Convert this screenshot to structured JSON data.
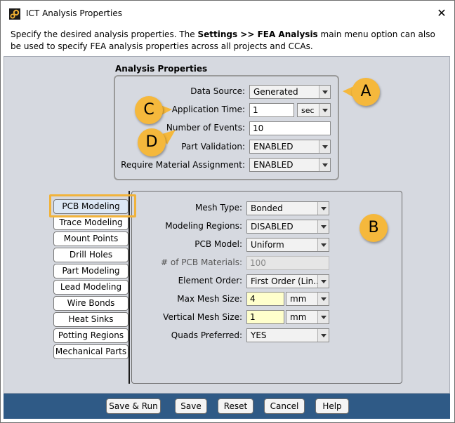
{
  "window": {
    "title": "ICT Analysis Properties",
    "close_glyph": "✕",
    "icon": "app-gear-icon"
  },
  "description": {
    "pre": "Specify the desired analysis properties. The ",
    "bold": "Settings >> FEA Analysis",
    "post": " main menu option can also be used to specify FEA analysis properties across all projects and CCAs."
  },
  "analysis_properties": {
    "title": "Analysis Properties",
    "data_source": {
      "label": "Data Source:",
      "value": "Generated"
    },
    "application_time": {
      "label": "Application Time:",
      "value": "1",
      "unit": "sec"
    },
    "number_of_events": {
      "label": "Number of Events:",
      "value": "10"
    },
    "part_validation": {
      "label": "Part Validation:",
      "value": "ENABLED"
    },
    "require_material": {
      "label": "Require Material Assignment:",
      "value": "ENABLED"
    }
  },
  "tabs": [
    {
      "label": "PCB Modeling",
      "active": true
    },
    {
      "label": "Trace Modeling"
    },
    {
      "label": "Mount Points"
    },
    {
      "label": "Drill Holes"
    },
    {
      "label": "Part Modeling"
    },
    {
      "label": "Lead Modeling"
    },
    {
      "label": "Wire Bonds"
    },
    {
      "label": "Heat Sinks"
    },
    {
      "label": "Potting Regions"
    },
    {
      "label": "Mechanical Parts"
    }
  ],
  "pcb_modeling": {
    "mesh_type": {
      "label": "Mesh Type:",
      "value": "Bonded"
    },
    "modeling_regions": {
      "label": "Modeling Regions:",
      "value": "DISABLED"
    },
    "pcb_model": {
      "label": "PCB Model:",
      "value": "Uniform"
    },
    "num_pcb_materials": {
      "label": "# of PCB Materials:",
      "value": "100"
    },
    "element_order": {
      "label": "Element Order:",
      "value": "First Order (Lin..."
    },
    "max_mesh_size": {
      "label": "Max Mesh Size:",
      "value": "4",
      "unit": "mm"
    },
    "vertical_mesh_size": {
      "label": "Vertical Mesh Size:",
      "value": "1",
      "unit": "mm"
    },
    "quads_preferred": {
      "label": "Quads Preferred:",
      "value": "YES"
    }
  },
  "callouts": {
    "a": "A",
    "b": "B",
    "c": "C",
    "d": "D"
  },
  "buttons": {
    "save_run": "Save & Run",
    "save": "Save",
    "reset": "Reset",
    "cancel": "Cancel",
    "help": "Help"
  },
  "colors": {
    "panel_bg": "#d6d9e0",
    "footer_bg": "#2f5a86",
    "callout": "#f5b83c",
    "highlight_input": "#ffffcc"
  }
}
